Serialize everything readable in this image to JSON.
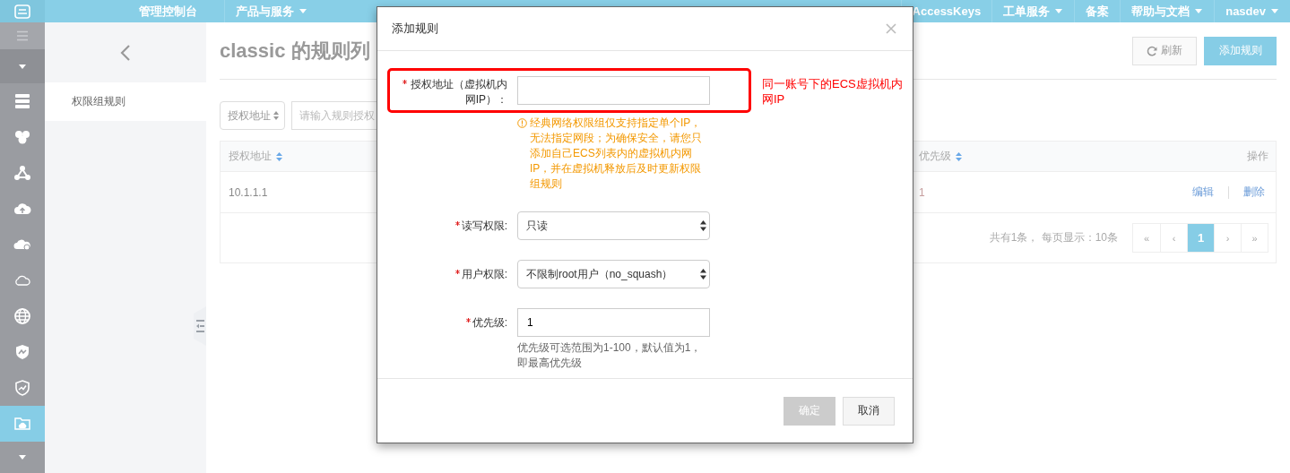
{
  "topbar": {
    "console": "管理控制台",
    "products": "产品与服务",
    "access_keys": "AccessKeys",
    "tickets": "工单服务",
    "filing": "备案",
    "help": "帮助与文档",
    "user": "nasdev"
  },
  "rail": [
    {
      "kind": "servers",
      "selected": false
    },
    {
      "kind": "cluster",
      "selected": false
    },
    {
      "kind": "network",
      "selected": false
    },
    {
      "kind": "cloud-upload",
      "selected": false
    },
    {
      "kind": "cloud",
      "selected": false
    },
    {
      "kind": "cloud-outline",
      "selected": false
    },
    {
      "kind": "globe",
      "selected": false
    },
    {
      "kind": "shield",
      "selected": false
    },
    {
      "kind": "shield-check",
      "selected": false
    },
    {
      "kind": "folder",
      "selected": true
    }
  ],
  "sidebar": {
    "items": [
      {
        "label": "权限组规则",
        "selected": true
      }
    ]
  },
  "page": {
    "title": "classic 的规则列",
    "refresh": "刷新",
    "add": "添加规则"
  },
  "filter": {
    "field": "授权地址",
    "placeholder": "请输入规则授权"
  },
  "table": {
    "columns": [
      {
        "label": "授权地址",
        "sortable": true
      },
      {
        "label": "优先级",
        "sortable": true
      },
      {
        "label": "操作",
        "sortable": false
      }
    ],
    "rows": [
      {
        "address": "10.1.1.1",
        "priority": "1",
        "actions": [
          "编辑",
          "删除"
        ]
      }
    ],
    "summary": "共有1条， 每页显示：10条",
    "pages": [
      {
        "label": "«",
        "selected": false
      },
      {
        "label": "‹",
        "selected": false
      },
      {
        "label": "1",
        "selected": true
      },
      {
        "label": "›",
        "selected": false
      },
      {
        "label": "»",
        "selected": false
      }
    ]
  },
  "dialog": {
    "title": "添加规则",
    "fields": [
      {
        "kind": "input",
        "label": "授权地址（虚拟机内网IP）：",
        "required": true,
        "warning": "经典网络权限组仅支持指定单个IP，无法指定网段；为确保安全，请您只添加自己ECS列表内的虚拟机内网IP，并在虚拟机释放后及时更新权限组规则"
      },
      {
        "kind": "select",
        "label": "读写权限:",
        "required": true,
        "value": "只读"
      },
      {
        "kind": "select",
        "label": "用户权限:",
        "required": true,
        "value": "不限制root用户（no_squash）"
      },
      {
        "kind": "input",
        "label": "优先级:",
        "required": true,
        "value": "1",
        "help": "优先级可选范围为1-100，默认值为1，即最高优先级"
      }
    ],
    "buttons": [
      {
        "label": "确定",
        "kind": "primary",
        "disabled": true
      },
      {
        "label": "取消",
        "kind": "default",
        "disabled": false
      }
    ]
  },
  "annotation": {
    "text": "同一账号下的ECS虚拟机内网IP"
  }
}
